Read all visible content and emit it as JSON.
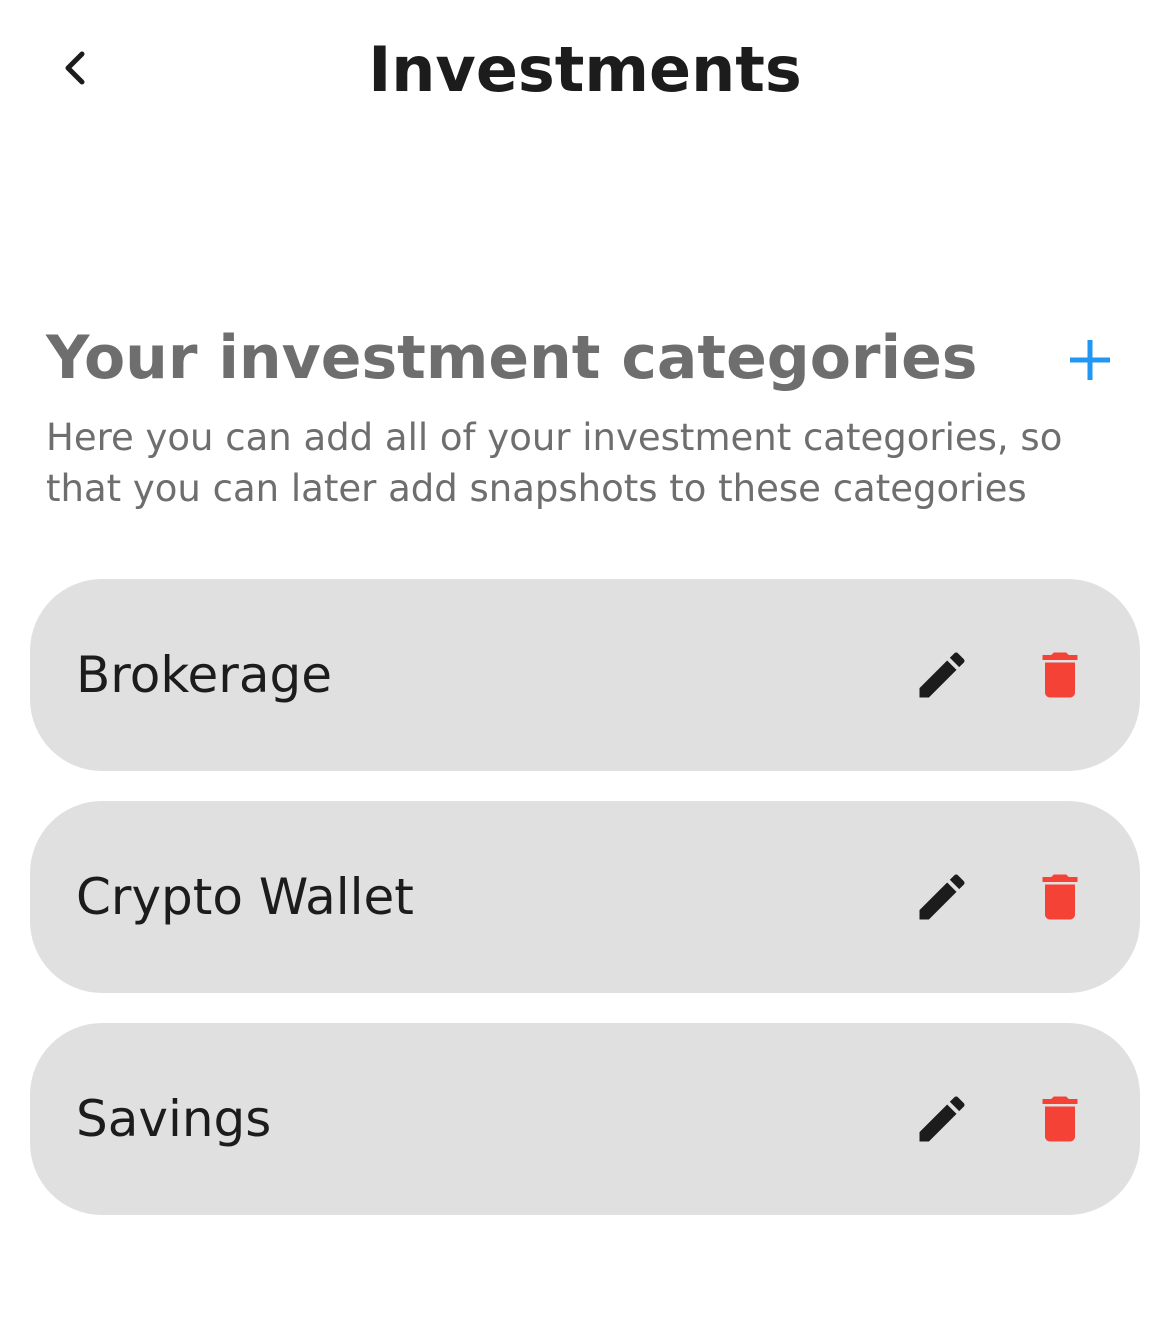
{
  "nav": {
    "title": "Investments",
    "back_icon": "chevron-left-icon"
  },
  "section": {
    "title": "Your investment categories",
    "description": "Here you can add all of your investment categories, so that you can later add snapshots to these categories",
    "add_icon": "plus-icon"
  },
  "colors": {
    "accent": "#2196f3",
    "delete": "#f44336",
    "card_background": "#e0e0e0",
    "secondary_text": "#6e6e6e"
  },
  "categories": [
    {
      "name": "Brokerage",
      "edit_icon": "pencil-icon",
      "delete_icon": "trash-icon"
    },
    {
      "name": "Crypto Wallet",
      "edit_icon": "pencil-icon",
      "delete_icon": "trash-icon"
    },
    {
      "name": "Savings",
      "edit_icon": "pencil-icon",
      "delete_icon": "trash-icon"
    }
  ]
}
